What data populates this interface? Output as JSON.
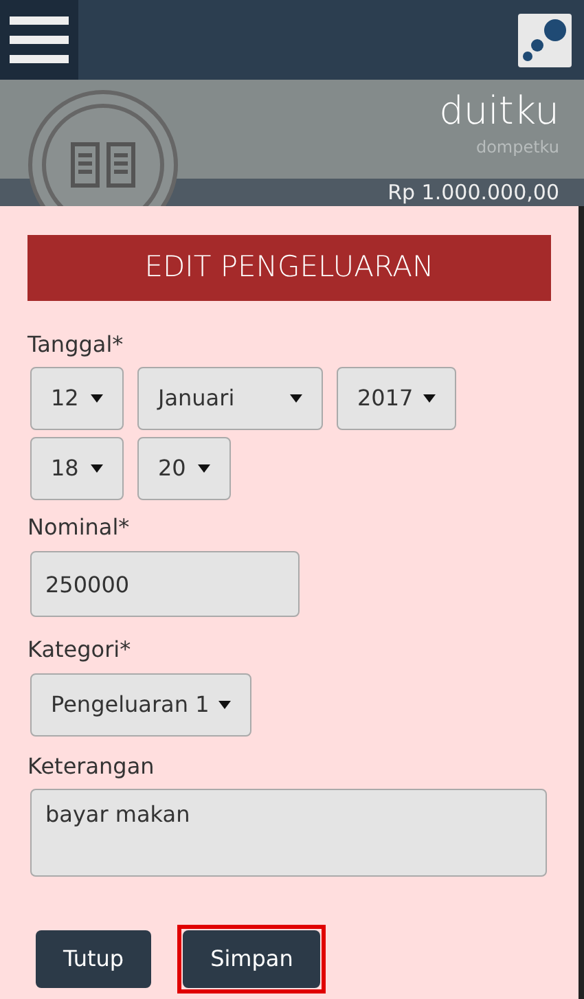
{
  "app": {
    "title": "duitku",
    "subtitle": "dompetku",
    "balance": "Rp 1.000.000,00"
  },
  "dialog": {
    "title": "EDIT PENGELUARAN",
    "date": {
      "label": "Tanggal*",
      "day": "12",
      "month": "Januari",
      "year": "2017",
      "hour": "18",
      "minute": "20"
    },
    "amount": {
      "label": "Nominal*",
      "value": "250000"
    },
    "category": {
      "label": "Kategori*",
      "value": "Pengeluaran 1"
    },
    "note": {
      "label": "Keterangan",
      "value": "bayar makan"
    },
    "buttons": [
      {
        "label": "Tutup",
        "highlighted": false
      },
      {
        "label": "Simpan",
        "highlighted": true
      }
    ]
  }
}
